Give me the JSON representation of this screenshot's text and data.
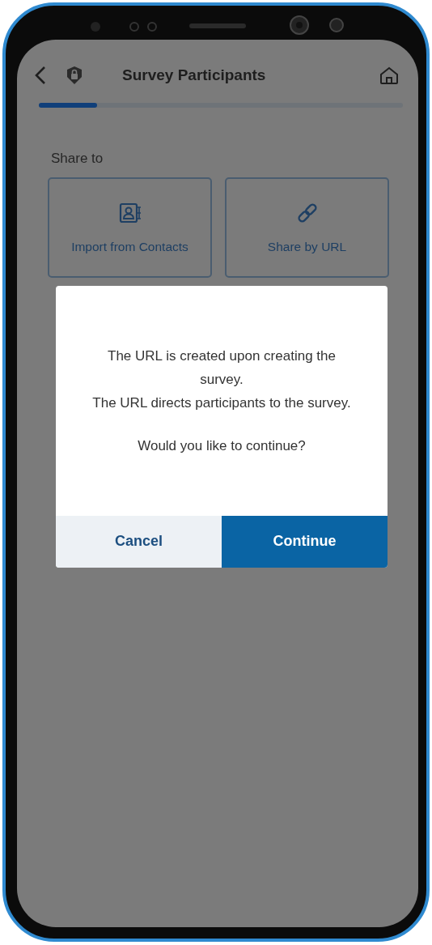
{
  "header": {
    "title": "Survey Participants"
  },
  "progress": {
    "level": 0.16
  },
  "share": {
    "label": "Share to",
    "options": [
      {
        "kind": "contacts",
        "label": "Import from Contacts"
      },
      {
        "kind": "url",
        "label": "Share by URL"
      }
    ]
  },
  "dialog": {
    "message": [
      "The URL is created upon creating the survey.",
      "The URL directs participants to the survey."
    ],
    "question": "Would you like to continue?",
    "buttons": [
      {
        "kind": "secondary",
        "label": "Cancel"
      },
      {
        "kind": "primary",
        "label": "Continue"
      }
    ]
  }
}
